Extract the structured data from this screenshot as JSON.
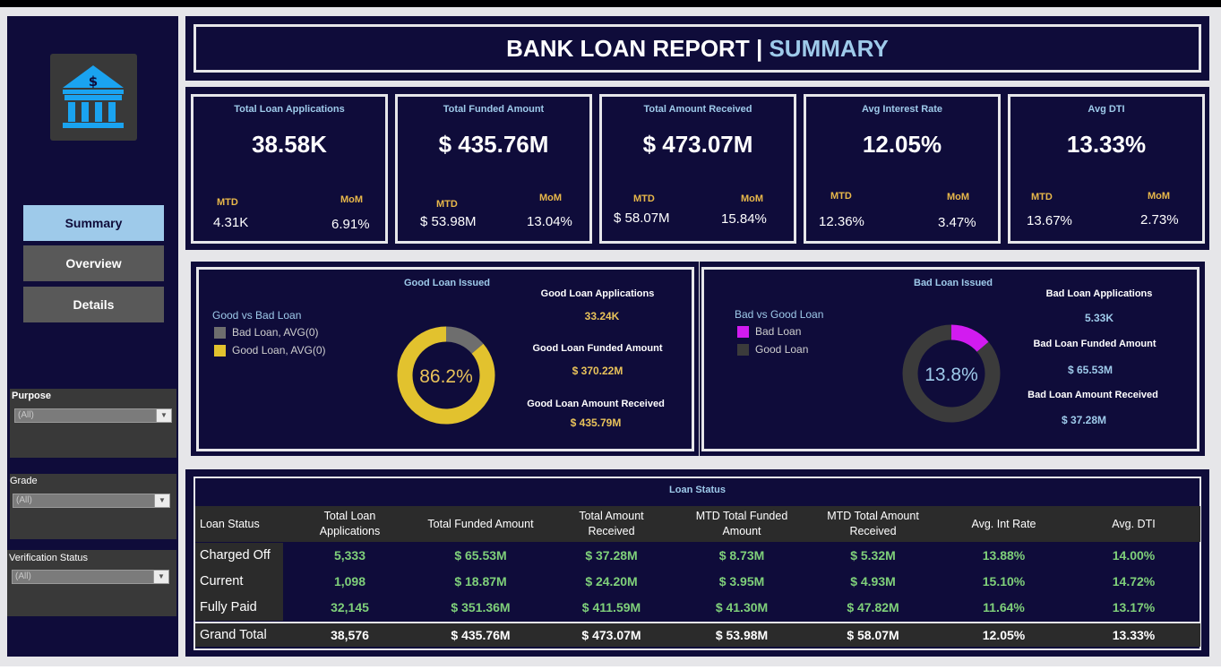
{
  "header": {
    "title_main": "BANK LOAN REPORT",
    "title_sep": " | ",
    "title_accent": "SUMMARY"
  },
  "sidebar": {
    "logo_icon": "bank-icon",
    "nav": [
      {
        "label": "Summary",
        "active": true
      },
      {
        "label": "Overview",
        "active": false
      },
      {
        "label": "Details",
        "active": false
      }
    ],
    "filters": [
      {
        "label": "Purpose",
        "value": "(All)"
      },
      {
        "label": "Grade",
        "value": "(All)"
      },
      {
        "label": "Verification Status",
        "value": "(All)"
      }
    ],
    "dropdown_icon": "▼"
  },
  "kpis": [
    {
      "title": "Total Loan Applications",
      "value": "38.58K",
      "mtd_label": "MTD",
      "mtd": "4.31K",
      "mom_label": "MoM",
      "mom": "6.91%"
    },
    {
      "title": "Total Funded Amount",
      "value": "$ 435.76M",
      "mtd_label": "MTD",
      "mtd": "$ 53.98M",
      "mom_label": "MoM",
      "mom": "13.04%"
    },
    {
      "title": "Total Amount Received",
      "value": "$ 473.07M",
      "mtd_label": "MTD",
      "mtd": "$ 58.07M",
      "mom_label": "MoM",
      "mom": "15.84%"
    },
    {
      "title": "Avg Interest Rate",
      "value": "12.05%",
      "mtd_label": "MTD",
      "mtd": "12.36%",
      "mom_label": "MoM",
      "mom": "3.47%"
    },
    {
      "title": "Avg DTI",
      "value": "13.33%",
      "mtd_label": "MTD",
      "mtd": "13.67%",
      "mom_label": "MoM",
      "mom": "2.73%"
    }
  ],
  "good_panel": {
    "title": "Good Loan Issued",
    "legend_title": "Good vs Bad Loan",
    "legend": [
      {
        "label": "Bad Loan, AVG(0)",
        "color": "#6e6e6e"
      },
      {
        "label": "Good Loan, AVG(0)",
        "color": "#e2c22e"
      }
    ],
    "donut_label": "86.2%",
    "metrics": [
      {
        "label": "Good Loan Applications",
        "value": "33.24K"
      },
      {
        "label": "Good Loan Funded Amount",
        "value": "$ 370.22M"
      },
      {
        "label": "Good Loan Amount Received",
        "value": "$ 435.79M"
      }
    ],
    "accent": "#e8c25a"
  },
  "bad_panel": {
    "title": "Bad Loan Issued",
    "legend_title": "Bad vs Good Loan",
    "legend": [
      {
        "label": "Bad Loan",
        "color": "#d21bf0"
      },
      {
        "label": "Good Loan",
        "color": "#3b3b3b"
      }
    ],
    "donut_label": "13.8%",
    "metrics": [
      {
        "label": "Bad Loan Applications",
        "value": "5.33K"
      },
      {
        "label": "Bad Loan Funded Amount",
        "value": "$ 65.53M"
      },
      {
        "label": "Bad Loan Amount Received",
        "value": "$ 37.28M"
      }
    ],
    "accent": "#9ecaea"
  },
  "chart_data": [
    {
      "type": "pie",
      "categories": [
        "Good Loan",
        "Bad Loan"
      ],
      "values": [
        86.2,
        13.8
      ]
    },
    {
      "type": "pie",
      "categories": [
        "Bad Loan",
        "Good Loan"
      ],
      "values": [
        13.8,
        86.2
      ]
    }
  ],
  "table": {
    "title": "Loan Status",
    "headers": [
      "Loan Status",
      "Total Loan Applications",
      "Total Funded Amount",
      "Total Amount Received",
      "MTD Total Funded Amount",
      "MTD Total Amount Received",
      "Avg. Int Rate",
      "Avg. DTI"
    ],
    "rows": [
      [
        "Charged Off",
        "5,333",
        "$ 65.53M",
        "$ 37.28M",
        "$ 8.73M",
        "$ 5.32M",
        "13.88%",
        "14.00%"
      ],
      [
        "Current",
        "1,098",
        "$ 18.87M",
        "$ 24.20M",
        "$ 3.95M",
        "$ 4.93M",
        "15.10%",
        "14.72%"
      ],
      [
        "Fully Paid",
        "32,145",
        "$ 351.36M",
        "$ 411.59M",
        "$ 41.30M",
        "$ 47.82M",
        "11.64%",
        "13.17%"
      ]
    ],
    "grand_total": [
      "Grand Total",
      "38,576",
      "$ 435.76M",
      "$ 473.07M",
      "$ 53.98M",
      "$ 58.07M",
      "12.05%",
      "13.33%"
    ]
  },
  "colors": {
    "navy": "#0f0c3a",
    "accent_blue": "#9ecaea",
    "gold": "#e8b84a",
    "green": "#7fd07a"
  }
}
